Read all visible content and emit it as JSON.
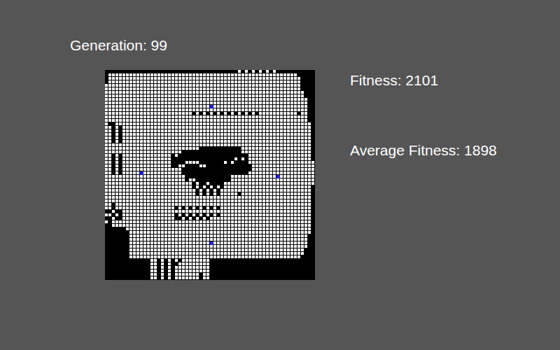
{
  "generation": {
    "label": "Generation: 99"
  },
  "stats": [
    {
      "label": "Fitness: 2101"
    },
    {
      "label": "Average Fitness: 1898"
    }
  ],
  "grid": {
    "columns": 60,
    "rows": [
      [
        [
          38,
          38
        ],
        [
          40,
          40
        ],
        [
          42,
          42
        ],
        [
          44,
          44
        ],
        [
          46,
          46
        ],
        [
          48,
          48
        ]
      ],
      [
        [
          1,
          54
        ]
      ],
      [
        [
          1,
          55
        ]
      ],
      [
        [
          1,
          55
        ]
      ],
      [
        [
          0,
          55
        ]
      ],
      [
        [
          0,
          55
        ]
      ],
      [
        [
          0,
          56
        ]
      ],
      [
        [
          0,
          56
        ]
      ],
      [
        [
          0,
          57
        ]
      ],
      [
        [
          0,
          57
        ]
      ],
      [
        [
          0,
          57
        ]
      ],
      [
        [
          0,
          57
        ]
      ],
      [
        [
          0,
          24
        ],
        [
          26,
          26
        ],
        [
          28,
          28
        ],
        [
          30,
          30
        ],
        [
          32,
          32
        ],
        [
          34,
          34
        ],
        [
          36,
          36
        ],
        [
          38,
          38
        ],
        [
          40,
          40
        ],
        [
          42,
          42
        ],
        [
          44,
          54
        ],
        [
          56,
          57
        ]
      ],
      [
        [
          0,
          57
        ]
      ],
      [
        [
          0,
          57
        ]
      ],
      [
        [
          0,
          0
        ],
        [
          3,
          58
        ]
      ],
      [
        [
          0,
          1
        ],
        [
          3,
          3
        ],
        [
          5,
          58
        ]
      ],
      [
        [
          0,
          1
        ],
        [
          3,
          3
        ],
        [
          5,
          58
        ]
      ],
      [
        [
          0,
          1
        ],
        [
          3,
          3
        ],
        [
          5,
          58
        ]
      ],
      [
        [
          0,
          1
        ],
        [
          3,
          3
        ],
        [
          5,
          58
        ]
      ],
      [
        [
          0,
          1
        ],
        [
          3,
          3
        ],
        [
          5,
          58
        ]
      ],
      [
        [
          0,
          58
        ]
      ],
      [
        [
          0,
          26
        ],
        [
          39,
          58
        ]
      ],
      [
        [
          0,
          21
        ],
        [
          39,
          58
        ]
      ],
      [
        [
          0,
          1
        ],
        [
          3,
          3
        ],
        [
          5,
          18
        ],
        [
          20,
          20
        ],
        [
          41,
          58
        ]
      ],
      [
        [
          0,
          1
        ],
        [
          3,
          3
        ],
        [
          5,
          18
        ],
        [
          37,
          37
        ],
        [
          39,
          39
        ],
        [
          41,
          58
        ]
      ],
      [
        [
          0,
          1
        ],
        [
          3,
          3
        ],
        [
          5,
          18
        ],
        [
          23,
          26
        ],
        [
          34,
          34
        ],
        [
          36,
          36
        ],
        [
          41,
          59
        ]
      ],
      [
        [
          0,
          1
        ],
        [
          3,
          3
        ],
        [
          5,
          18
        ],
        [
          21,
          22
        ],
        [
          27,
          28
        ],
        [
          42,
          59
        ]
      ],
      [
        [
          0,
          1
        ],
        [
          3,
          3
        ],
        [
          5,
          21
        ],
        [
          42,
          59
        ]
      ],
      [
        [
          0,
          1
        ],
        [
          3,
          3
        ],
        [
          5,
          21
        ],
        [
          41,
          59
        ]
      ],
      [
        [
          0,
          22
        ],
        [
          36,
          59
        ]
      ],
      [
        [
          0,
          22
        ],
        [
          24,
          25
        ],
        [
          36,
          59
        ]
      ],
      [
        [
          0,
          24
        ],
        [
          26,
          26
        ],
        [
          29,
          29
        ],
        [
          34,
          59
        ]
      ],
      [
        [
          0,
          24
        ],
        [
          26,
          26
        ],
        [
          28,
          28
        ],
        [
          30,
          30
        ],
        [
          32,
          32
        ],
        [
          34,
          58
        ]
      ],
      [
        [
          0,
          25
        ],
        [
          27,
          27
        ],
        [
          29,
          29
        ],
        [
          31,
          31
        ],
        [
          33,
          58
        ]
      ],
      [
        [
          0,
          25
        ],
        [
          27,
          27
        ],
        [
          29,
          29
        ],
        [
          31,
          31
        ],
        [
          33,
          37
        ],
        [
          39,
          58
        ]
      ],
      [
        [
          0,
          58
        ]
      ],
      [
        [
          0,
          58
        ]
      ],
      [
        [
          0,
          1
        ],
        [
          3,
          58
        ]
      ],
      [
        [
          0,
          1
        ],
        [
          3,
          19
        ],
        [
          21,
          21
        ],
        [
          23,
          23
        ],
        [
          25,
          25
        ],
        [
          27,
          27
        ],
        [
          29,
          29
        ],
        [
          31,
          31
        ],
        [
          33,
          58
        ]
      ],
      [
        [
          2,
          2
        ],
        [
          5,
          58
        ]
      ],
      [
        [
          0,
          1
        ],
        [
          3,
          3
        ],
        [
          5,
          19
        ],
        [
          21,
          21
        ],
        [
          23,
          23
        ],
        [
          25,
          25
        ],
        [
          27,
          27
        ],
        [
          29,
          29
        ],
        [
          31,
          31
        ],
        [
          33,
          58
        ]
      ],
      [
        [
          2,
          2
        ],
        [
          5,
          19
        ],
        [
          22,
          22
        ],
        [
          24,
          24
        ],
        [
          26,
          26
        ],
        [
          28,
          28
        ],
        [
          30,
          58
        ]
      ],
      [
        [
          0,
          0
        ],
        [
          2,
          58
        ]
      ],
      [
        [
          2,
          58
        ]
      ],
      [
        [
          6,
          58
        ]
      ],
      [
        [
          7,
          58
        ]
      ],
      [
        [
          7,
          57
        ]
      ],
      [
        [
          7,
          57
        ]
      ],
      [
        [
          7,
          57
        ]
      ],
      [
        [
          7,
          57
        ]
      ],
      [
        [
          7,
          56
        ]
      ],
      [
        [
          7,
          56
        ]
      ],
      [
        [
          7,
          55
        ]
      ],
      [
        [
          13,
          14
        ],
        [
          16,
          16
        ],
        [
          18,
          18
        ],
        [
          20,
          20
        ],
        [
          22,
          29
        ]
      ],
      [
        [
          13,
          14
        ],
        [
          16,
          16
        ],
        [
          18,
          18
        ],
        [
          21,
          29
        ]
      ],
      [
        [
          13,
          14
        ],
        [
          16,
          16
        ],
        [
          18,
          18
        ],
        [
          20,
          29
        ]
      ],
      [
        [
          13,
          14
        ],
        [
          16,
          16
        ],
        [
          18,
          18
        ],
        [
          20,
          29
        ]
      ],
      [
        [
          13,
          14
        ],
        [
          16,
          16
        ],
        [
          18,
          18
        ],
        [
          20,
          26
        ],
        [
          28,
          29
        ]
      ],
      [
        [
          13,
          14
        ],
        [
          16,
          16
        ],
        [
          18,
          18
        ],
        [
          20,
          26
        ],
        [
          28,
          29
        ]
      ]
    ]
  },
  "agents": [
    {
      "row": 10,
      "col": 30
    },
    {
      "row": 29,
      "col": 10
    },
    {
      "row": 30,
      "col": 49
    },
    {
      "row": 49,
      "col": 30
    }
  ]
}
